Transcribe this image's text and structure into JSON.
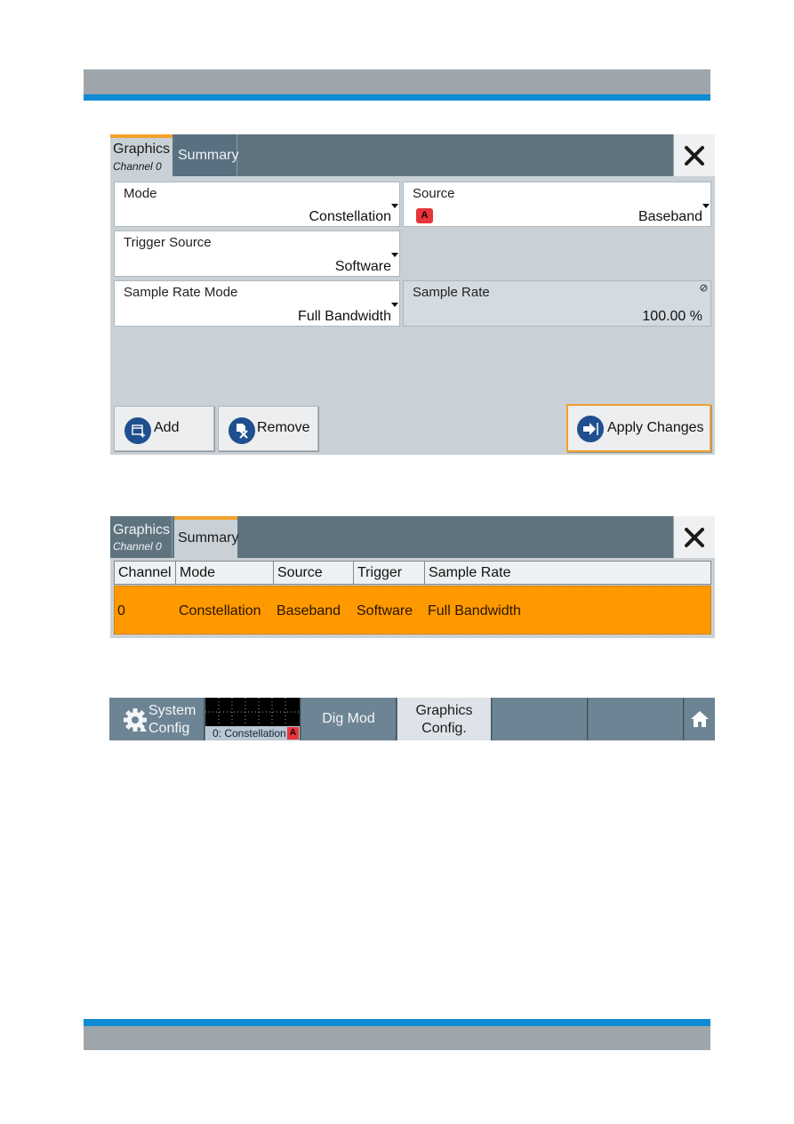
{
  "page": {
    "colors": {
      "accent_blue": "#0e8bd3",
      "header_gray": "#9fa6ab",
      "highlight_orange": "#ff9900",
      "tab_orange": "#f2a02b"
    }
  },
  "dialog1": {
    "tabs": [
      {
        "label": "Graphics",
        "sublabel": "Channel 0",
        "active": true
      },
      {
        "label": "Summary",
        "sublabel": "",
        "active": false
      }
    ],
    "close_icon": "close-x-icon",
    "fields": {
      "mode": {
        "label": "Mode",
        "value": "Constellation"
      },
      "source": {
        "label": "Source",
        "value": "Baseband",
        "badge": "A"
      },
      "trigger_source": {
        "label": "Trigger Source",
        "value": "Software"
      },
      "sample_rate_mode": {
        "label": "Sample Rate Mode",
        "value": "Full Bandwidth"
      },
      "sample_rate": {
        "label": "Sample Rate",
        "value": "100.00 %",
        "readonly_icon": "disabled-icon"
      }
    },
    "buttons": {
      "add": {
        "label": "Add",
        "icon": "add-window-icon"
      },
      "remove": {
        "label": "Remove",
        "icon": "remove-document-icon"
      },
      "apply": {
        "label": "Apply Changes",
        "icon": "arrow-right-icon"
      }
    }
  },
  "dialog2": {
    "tabs": [
      {
        "label": "Graphics",
        "sublabel": "Channel 0",
        "active": false
      },
      {
        "label": "Summary",
        "sublabel": "",
        "active": true
      }
    ],
    "table": {
      "columns": [
        "Channel",
        "Mode",
        "Source",
        "Trigger",
        "Sample Rate"
      ],
      "rows": [
        [
          "0",
          "Constellation",
          "Baseband",
          "Software",
          "Full Bandwidth"
        ]
      ]
    }
  },
  "taskbar": {
    "system_config": {
      "line1": "System",
      "line2": "Config",
      "icon": "gear-icon"
    },
    "graphics_thumb": {
      "label": "0: Constellation",
      "badge": "A"
    },
    "dig_mod": {
      "label": "Dig Mod"
    },
    "graphics_config": {
      "line1": "Graphics",
      "line2": "Config."
    },
    "home_icon": "home-icon"
  }
}
